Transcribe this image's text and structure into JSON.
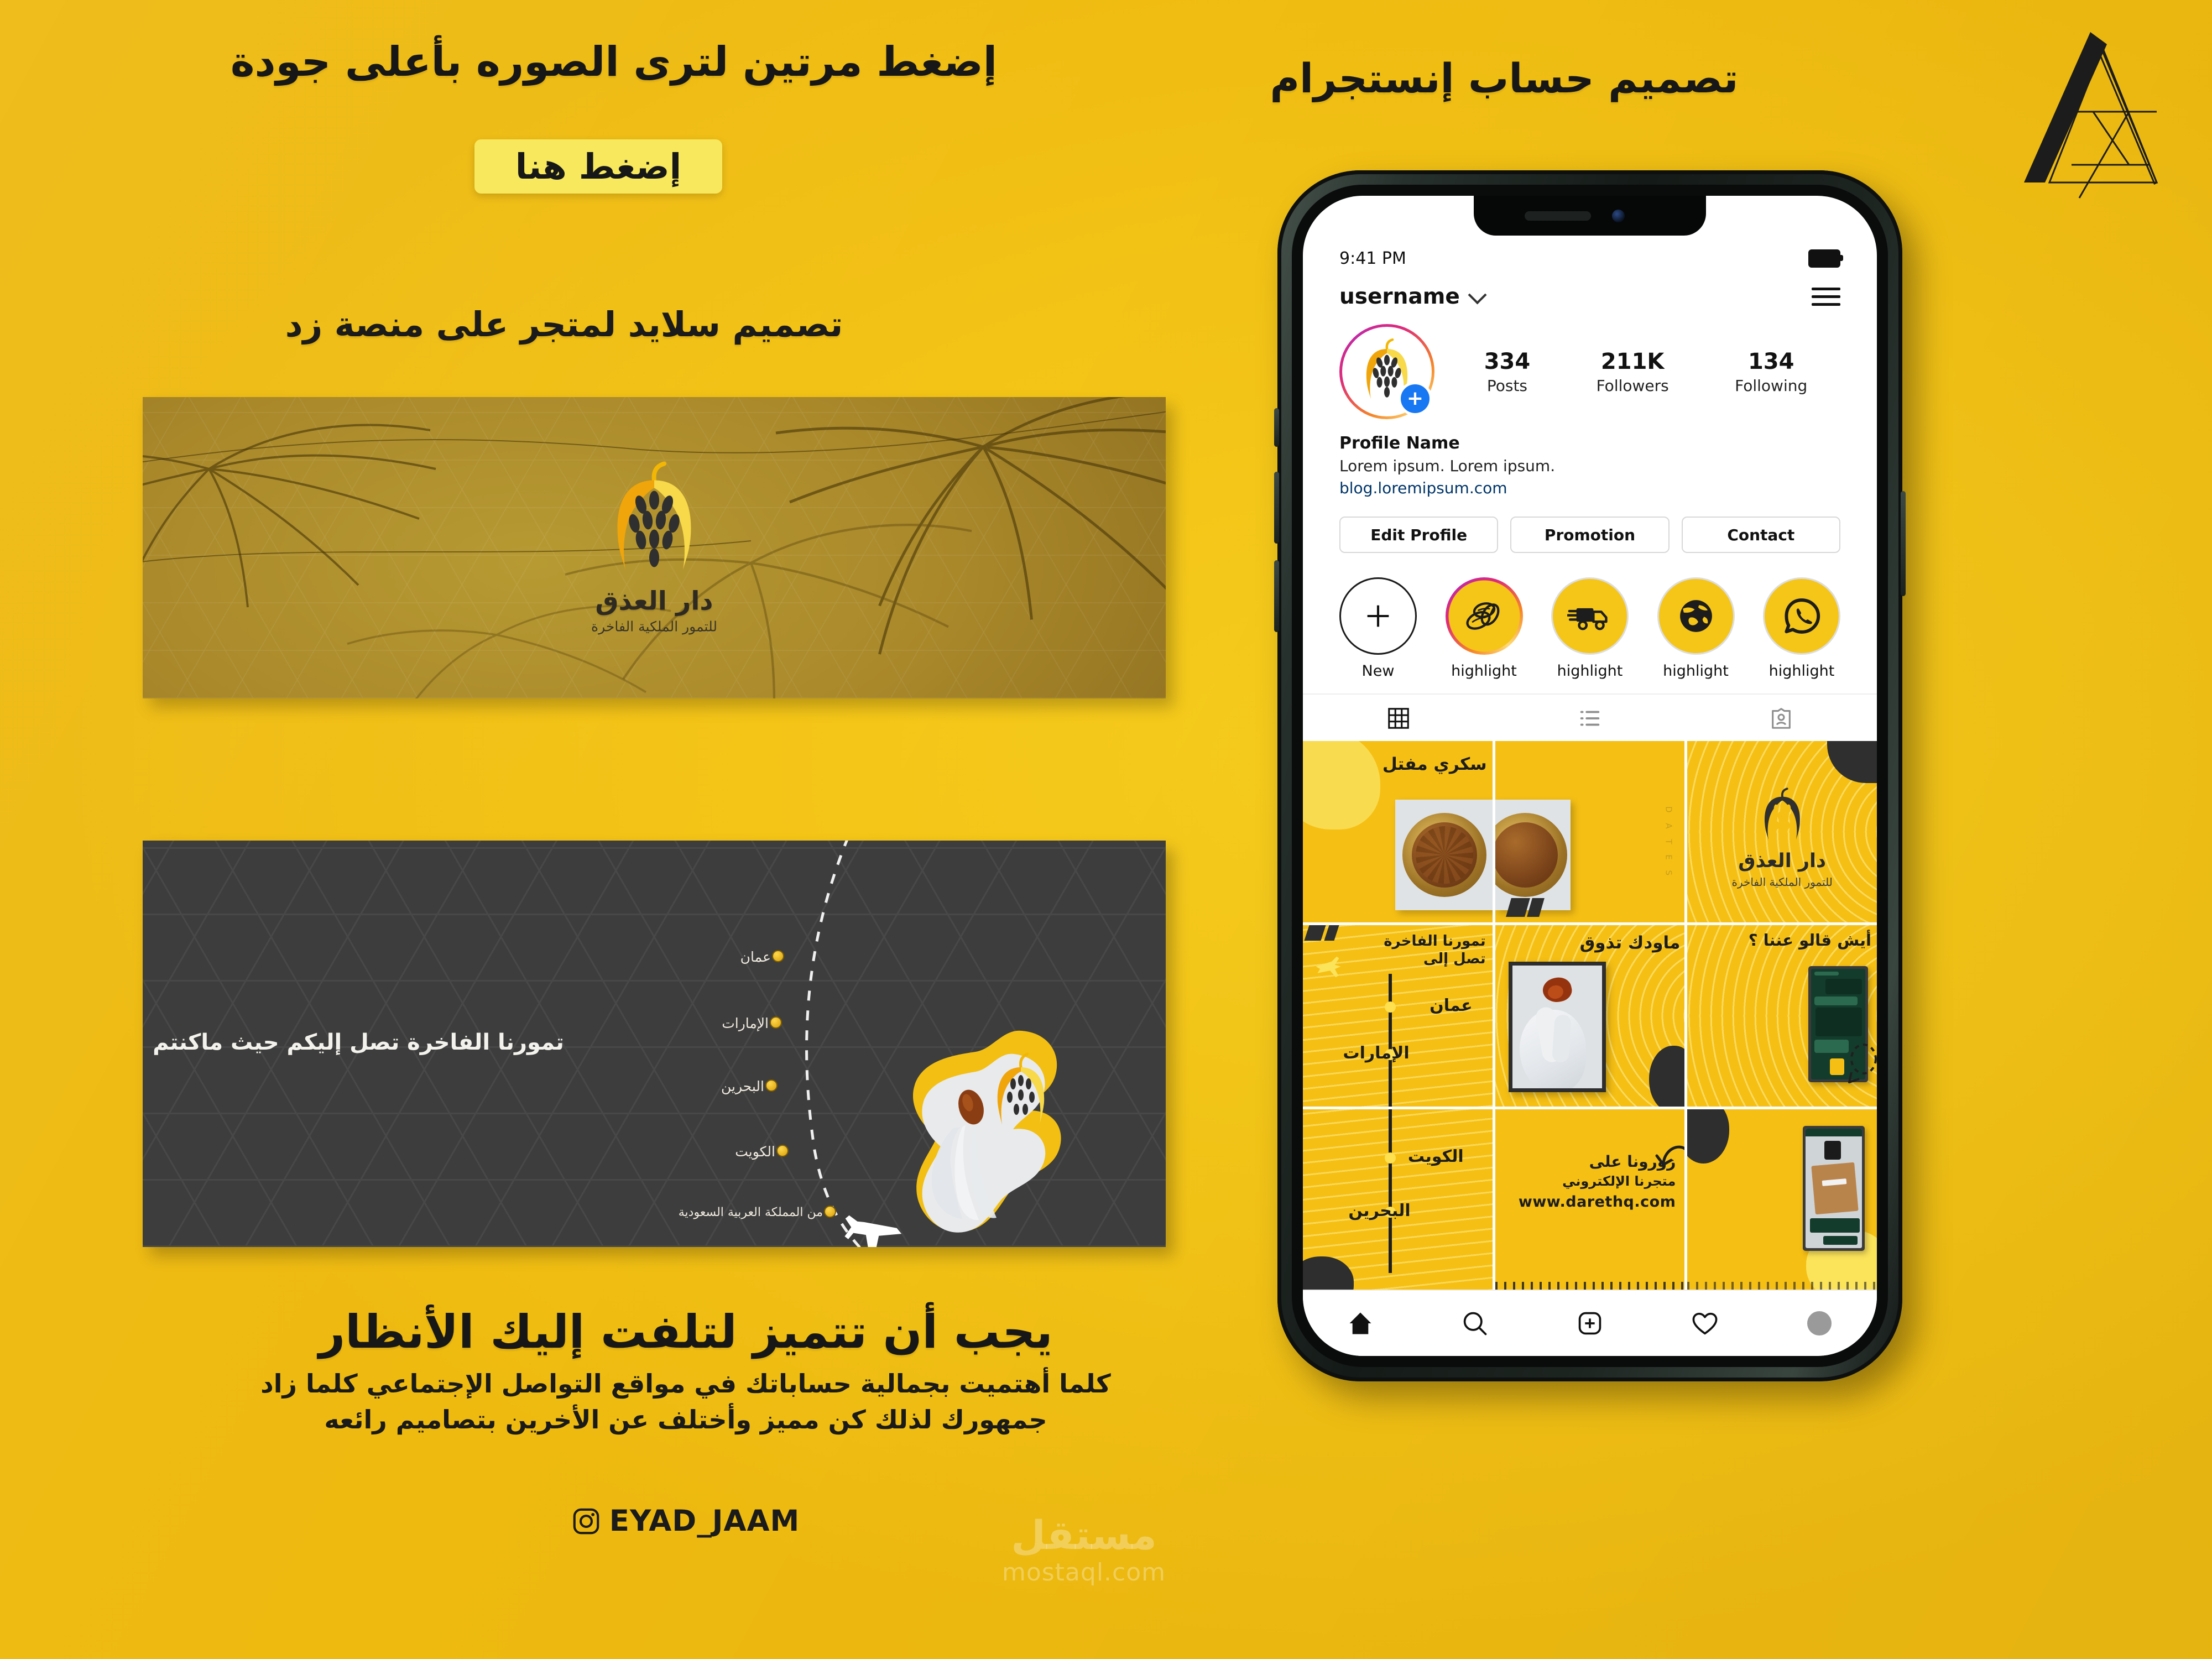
{
  "page": {
    "bg_color": "#f4c518",
    "accent_yellow": "#f5c518",
    "light_yellow": "#f7e85e",
    "dark_panel": "#3d3d3d",
    "ink": "#171717"
  },
  "top_left": {
    "headline": "إضغط مرتين لترى الصوره بأعلى جودة",
    "button_label": "إضغط هنا"
  },
  "top_right": {
    "headline": "تصميم حساب إنستجرام",
    "monogram_icon": "a-monogram-icon"
  },
  "section": {
    "title": "تصميم سلايد لمتجر على منصة زد"
  },
  "banner_palms": {
    "brand_name": "دار العذق",
    "brand_tagline": "للتمور الملكية الفاخرة",
    "logo_icon": "date-cluster-logo-icon"
  },
  "banner_map": {
    "tagline": "تمورنا الفاخرة تصل إليكم حيث ماكنتم",
    "origin_label": "من المملكة العربية السعودية",
    "stops": [
      "عمان",
      "الإمارات",
      "البحرين",
      "الكويت"
    ],
    "plane_icon": "airplane-icon"
  },
  "bottom": {
    "headline": "يجب أن تتميز لتلفت إليك الأنظار",
    "paragraph_line1": "كلما أهتميت بجمالية حساباتك في مواقع التواصل الإجتماعي كلما زاد",
    "paragraph_line2": "جمهورك لذلك كن مميز وأختلف عن الأخرين بتصاميم رائعه",
    "instagram_icon": "instagram-icon",
    "handle": "EYAD_JAAM",
    "watermark_ar": "مستقل",
    "watermark_en": "mostaql.com"
  },
  "phone": {
    "status": {
      "time": "9:41 PM",
      "battery_icon": "battery-full-icon"
    },
    "topbar": {
      "username": "username",
      "chevron_icon": "chevron-down-icon",
      "menu_icon": "hamburger-menu-icon"
    },
    "avatar": {
      "story_ring": true,
      "add_badge": "+",
      "logo_icon": "date-cluster-logo-icon"
    },
    "stats": [
      {
        "value": "334",
        "label": "Posts"
      },
      {
        "value": "211K",
        "label": "Followers"
      },
      {
        "value": "134",
        "label": "Following"
      }
    ],
    "bio": {
      "profile_name": "Profile Name",
      "description": "Lorem ipsum. Lorem ipsum.",
      "link": "blog.loremipsum.com"
    },
    "actions": [
      "Edit Profile",
      "Promotion",
      "Contact"
    ],
    "highlights": [
      {
        "label": "New",
        "icon": "plus-icon"
      },
      {
        "label": "highlight",
        "icon": "dates-icon"
      },
      {
        "label": "highlight",
        "icon": "delivery-truck-icon"
      },
      {
        "label": "highlight",
        "icon": "globe-icon"
      },
      {
        "label": "highlight",
        "icon": "whatsapp-icon"
      }
    ],
    "tabs": [
      {
        "icon": "grid-icon",
        "active": true
      },
      {
        "icon": "list-icon",
        "active": false
      },
      {
        "icon": "tagged-icon",
        "active": false
      }
    ],
    "grid_posts": [
      {
        "id": "p1",
        "headline_ar": "سكري مفتل",
        "side_label": "D A T E S",
        "kind": "product-photo"
      },
      {
        "id": "p2",
        "headline_ar": "",
        "side_label": "",
        "kind": "photo-half"
      },
      {
        "id": "p3",
        "headline_ar": "دار العذق",
        "side_label": "للتمور الملكية الفاخرة",
        "kind": "brand-logo"
      },
      {
        "id": "p4",
        "headline_ar": "تمورنا الفاخرة تصل إلى",
        "side_label": "",
        "kind": "shipping-map-top"
      },
      {
        "id": "p5",
        "headline_ar": "ماودك تذوق",
        "side_label": "",
        "kind": "taste-photo"
      },
      {
        "id": "p6",
        "headline_ar": "أيش قالو عننا ؟",
        "side_label": "",
        "kind": "testimonial"
      },
      {
        "id": "p7",
        "headline_ar": "",
        "side_label": "",
        "kind": "shipping-map-bottom"
      },
      {
        "id": "p8",
        "headline_ar": "زورونا على",
        "side_label": "متجرنا الإلكتروني",
        "kind": "store-cta",
        "url": "www.darethq.com"
      },
      {
        "id": "p9",
        "headline_ar": "",
        "side_label": "",
        "kind": "testimonial-2"
      }
    ],
    "grid_countries_top": [
      "عمان",
      "الإمارات"
    ],
    "grid_countries_bottom": [
      "الكويت",
      "البحرين"
    ],
    "bottom_nav": [
      {
        "icon": "home-icon",
        "active": true
      },
      {
        "icon": "search-icon",
        "active": false
      },
      {
        "icon": "add-post-icon",
        "active": false
      },
      {
        "icon": "heart-icon",
        "active": false
      },
      {
        "icon": "profile-avatar-icon",
        "active": false
      }
    ]
  }
}
